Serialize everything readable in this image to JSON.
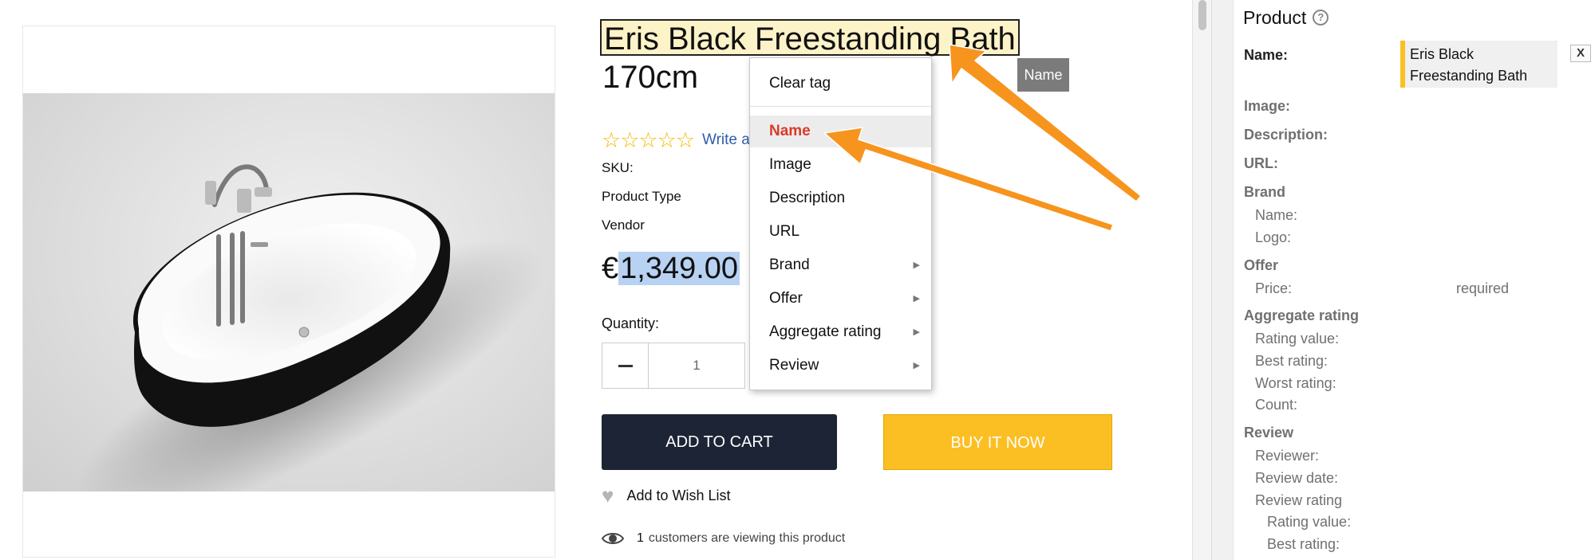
{
  "product": {
    "title_line1": "Eris Black Freestanding Bath",
    "title_line2": "170cm",
    "stars": "☆☆☆☆☆",
    "write_review": "Write a review",
    "sku_label": "SKU:",
    "type_label": "Product Type",
    "vendor_label": "Vendor",
    "currency": "€",
    "price": "1,349.00",
    "quantity_label": "Quantity:",
    "quantity_value": "1",
    "add_to_cart": "ADD TO CART",
    "buy_now": "BUY IT NOW",
    "wishlist": "Add to Wish List",
    "viewing_count": "1",
    "viewing_text": "customers are viewing this product"
  },
  "tag_badge": "Name",
  "context_menu": {
    "clear": "Clear tag",
    "items": [
      {
        "label": "Name",
        "submenu": false,
        "active": true
      },
      {
        "label": "Image",
        "submenu": false
      },
      {
        "label": "Description",
        "submenu": false
      },
      {
        "label": "URL",
        "submenu": false
      },
      {
        "label": "Brand",
        "submenu": true
      },
      {
        "label": "Offer",
        "submenu": true
      },
      {
        "label": "Aggregate rating",
        "submenu": true
      },
      {
        "label": "Review",
        "submenu": true
      }
    ],
    "submenu_arrow": "▶"
  },
  "panel": {
    "title": "Product",
    "help": "?",
    "name_label": "Name:",
    "name_value": "Eris Black Freestanding Bath",
    "clear_button": "X",
    "image_label": "Image:",
    "description_label": "Description:",
    "url_label": "URL:",
    "brand": {
      "label": "Brand",
      "name": "Name:",
      "logo": "Logo:"
    },
    "offer": {
      "label": "Offer",
      "price": "Price:",
      "required": "required"
    },
    "aggregate": {
      "label": "Aggregate rating",
      "rating_value": "Rating value:",
      "best": "Best rating:",
      "worst": "Worst rating:",
      "count": "Count:"
    },
    "review": {
      "label": "Review",
      "reviewer": "Reviewer:",
      "date": "Review date:",
      "rating": "Review rating",
      "rating_value": "Rating value:",
      "best": "Best rating:"
    }
  },
  "colors": {
    "accent": "#fcbf23",
    "dark_button": "#1d2436",
    "arrow": "#f7941d",
    "active_item": "#d93b2a"
  }
}
